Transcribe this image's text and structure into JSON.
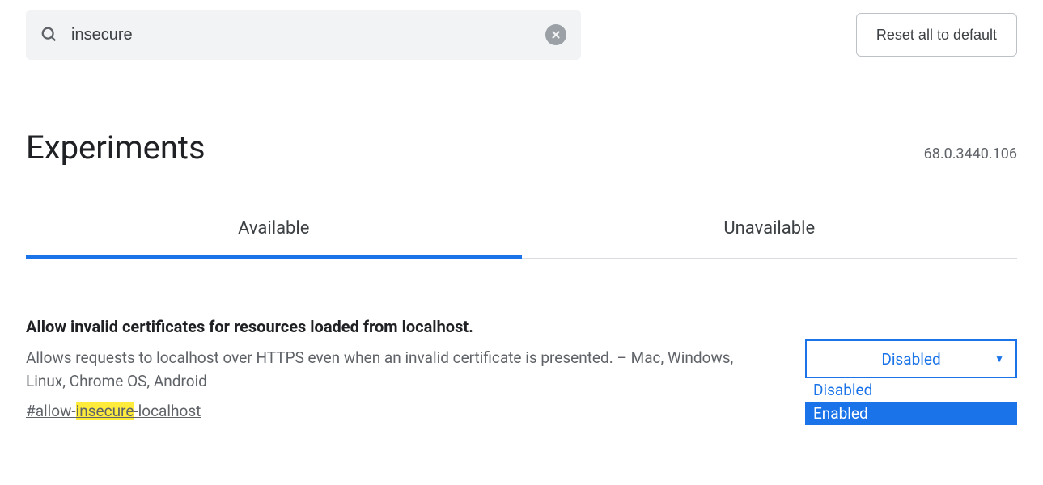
{
  "search": {
    "value": "insecure"
  },
  "reset_button": "Reset all to default",
  "page_title": "Experiments",
  "version": "68.0.3440.106",
  "tabs": {
    "available": "Available",
    "unavailable": "Unavailable"
  },
  "experiment": {
    "title": "Allow invalid certificates for resources loaded from localhost.",
    "description": "Allows requests to localhost over HTTPS even when an invalid certificate is presented. – Mac, Windows, Linux, Chrome OS, Android",
    "flag_prefix": "#allow-",
    "flag_highlight": "insecure",
    "flag_suffix": "-localhost",
    "select": {
      "value": "Disabled",
      "options": {
        "disabled": "Disabled",
        "enabled": "Enabled"
      }
    }
  }
}
